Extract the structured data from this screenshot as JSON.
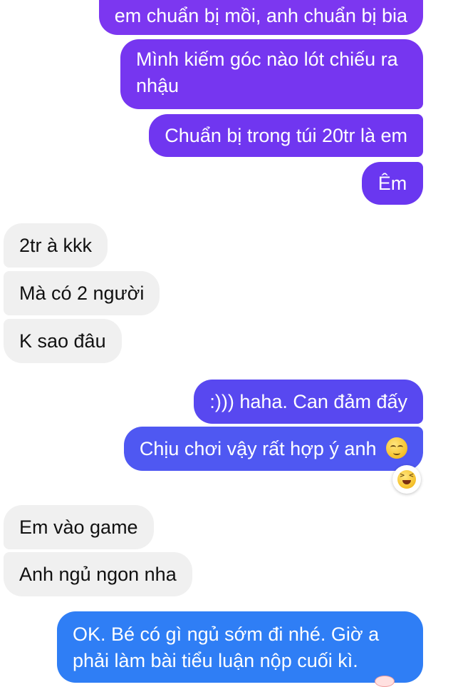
{
  "messages": [
    {
      "side": "sent",
      "text": "em chuẩn bị mồi, anh chuẩn bị bia"
    },
    {
      "side": "sent",
      "text": "Mình kiếm góc nào lót chiếu ra nhậu"
    },
    {
      "side": "sent",
      "text": "Chuẩn bị trong túi 20tr là em"
    },
    {
      "side": "sent",
      "text": "Êm"
    },
    {
      "side": "received",
      "text": "2tr à kkk"
    },
    {
      "side": "received",
      "text": "Mà có 2 người"
    },
    {
      "side": "received",
      "text": "K sao đâu"
    },
    {
      "side": "sent",
      "text": ":))) haha. Can đảm đấy"
    },
    {
      "side": "sent",
      "text": "Chịu chơi vậy rất hợp ý anh",
      "emoji": "relieved-face-emoji",
      "reaction": "laughing-face-emoji"
    },
    {
      "side": "received",
      "text": "Em vào game"
    },
    {
      "side": "received",
      "text": "Anh ngủ ngon nha"
    },
    {
      "side": "sent",
      "text": "OK. Bé có gì ngủ sớm đi nhé. Giờ a phải làm bài tiểu luận nộp cuối kì."
    }
  ],
  "colors": {
    "sent_top": "#7a3cf0",
    "sent_mid": "#5a4df0",
    "sent_bottom": "#2f7df5",
    "received_bg": "#f0f0f0"
  }
}
